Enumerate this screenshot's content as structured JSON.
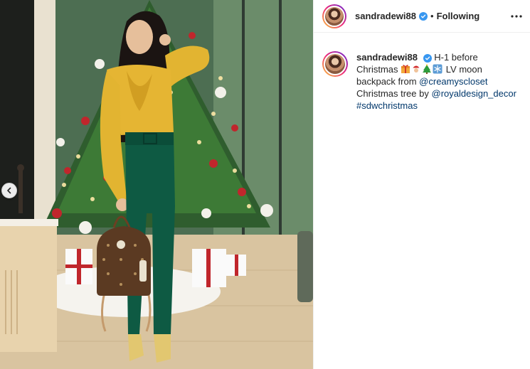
{
  "post": {
    "username": "sandradewi88",
    "follow_separator": "•",
    "follow_state": "Following",
    "caption": {
      "part1": "H-1 before Christmas",
      "emojis": [
        "gift-emoji",
        "santa-emoji",
        "christmas-tree-emoji",
        "snowflake-emoji"
      ],
      "part2": "LV moon backpack from",
      "mention1": "@creamyscloset",
      "part3": "Christmas tree by",
      "mention2": "@royaldesign_decor",
      "hashtag": "#sdwchristmas"
    }
  },
  "colors": {
    "link": "#00376b",
    "verified": "#3897f0",
    "border": "#efefef"
  },
  "icons": {
    "verified": "verified-badge-icon",
    "more": "more-options-icon",
    "carousel_prev": "chevron-left-icon"
  }
}
